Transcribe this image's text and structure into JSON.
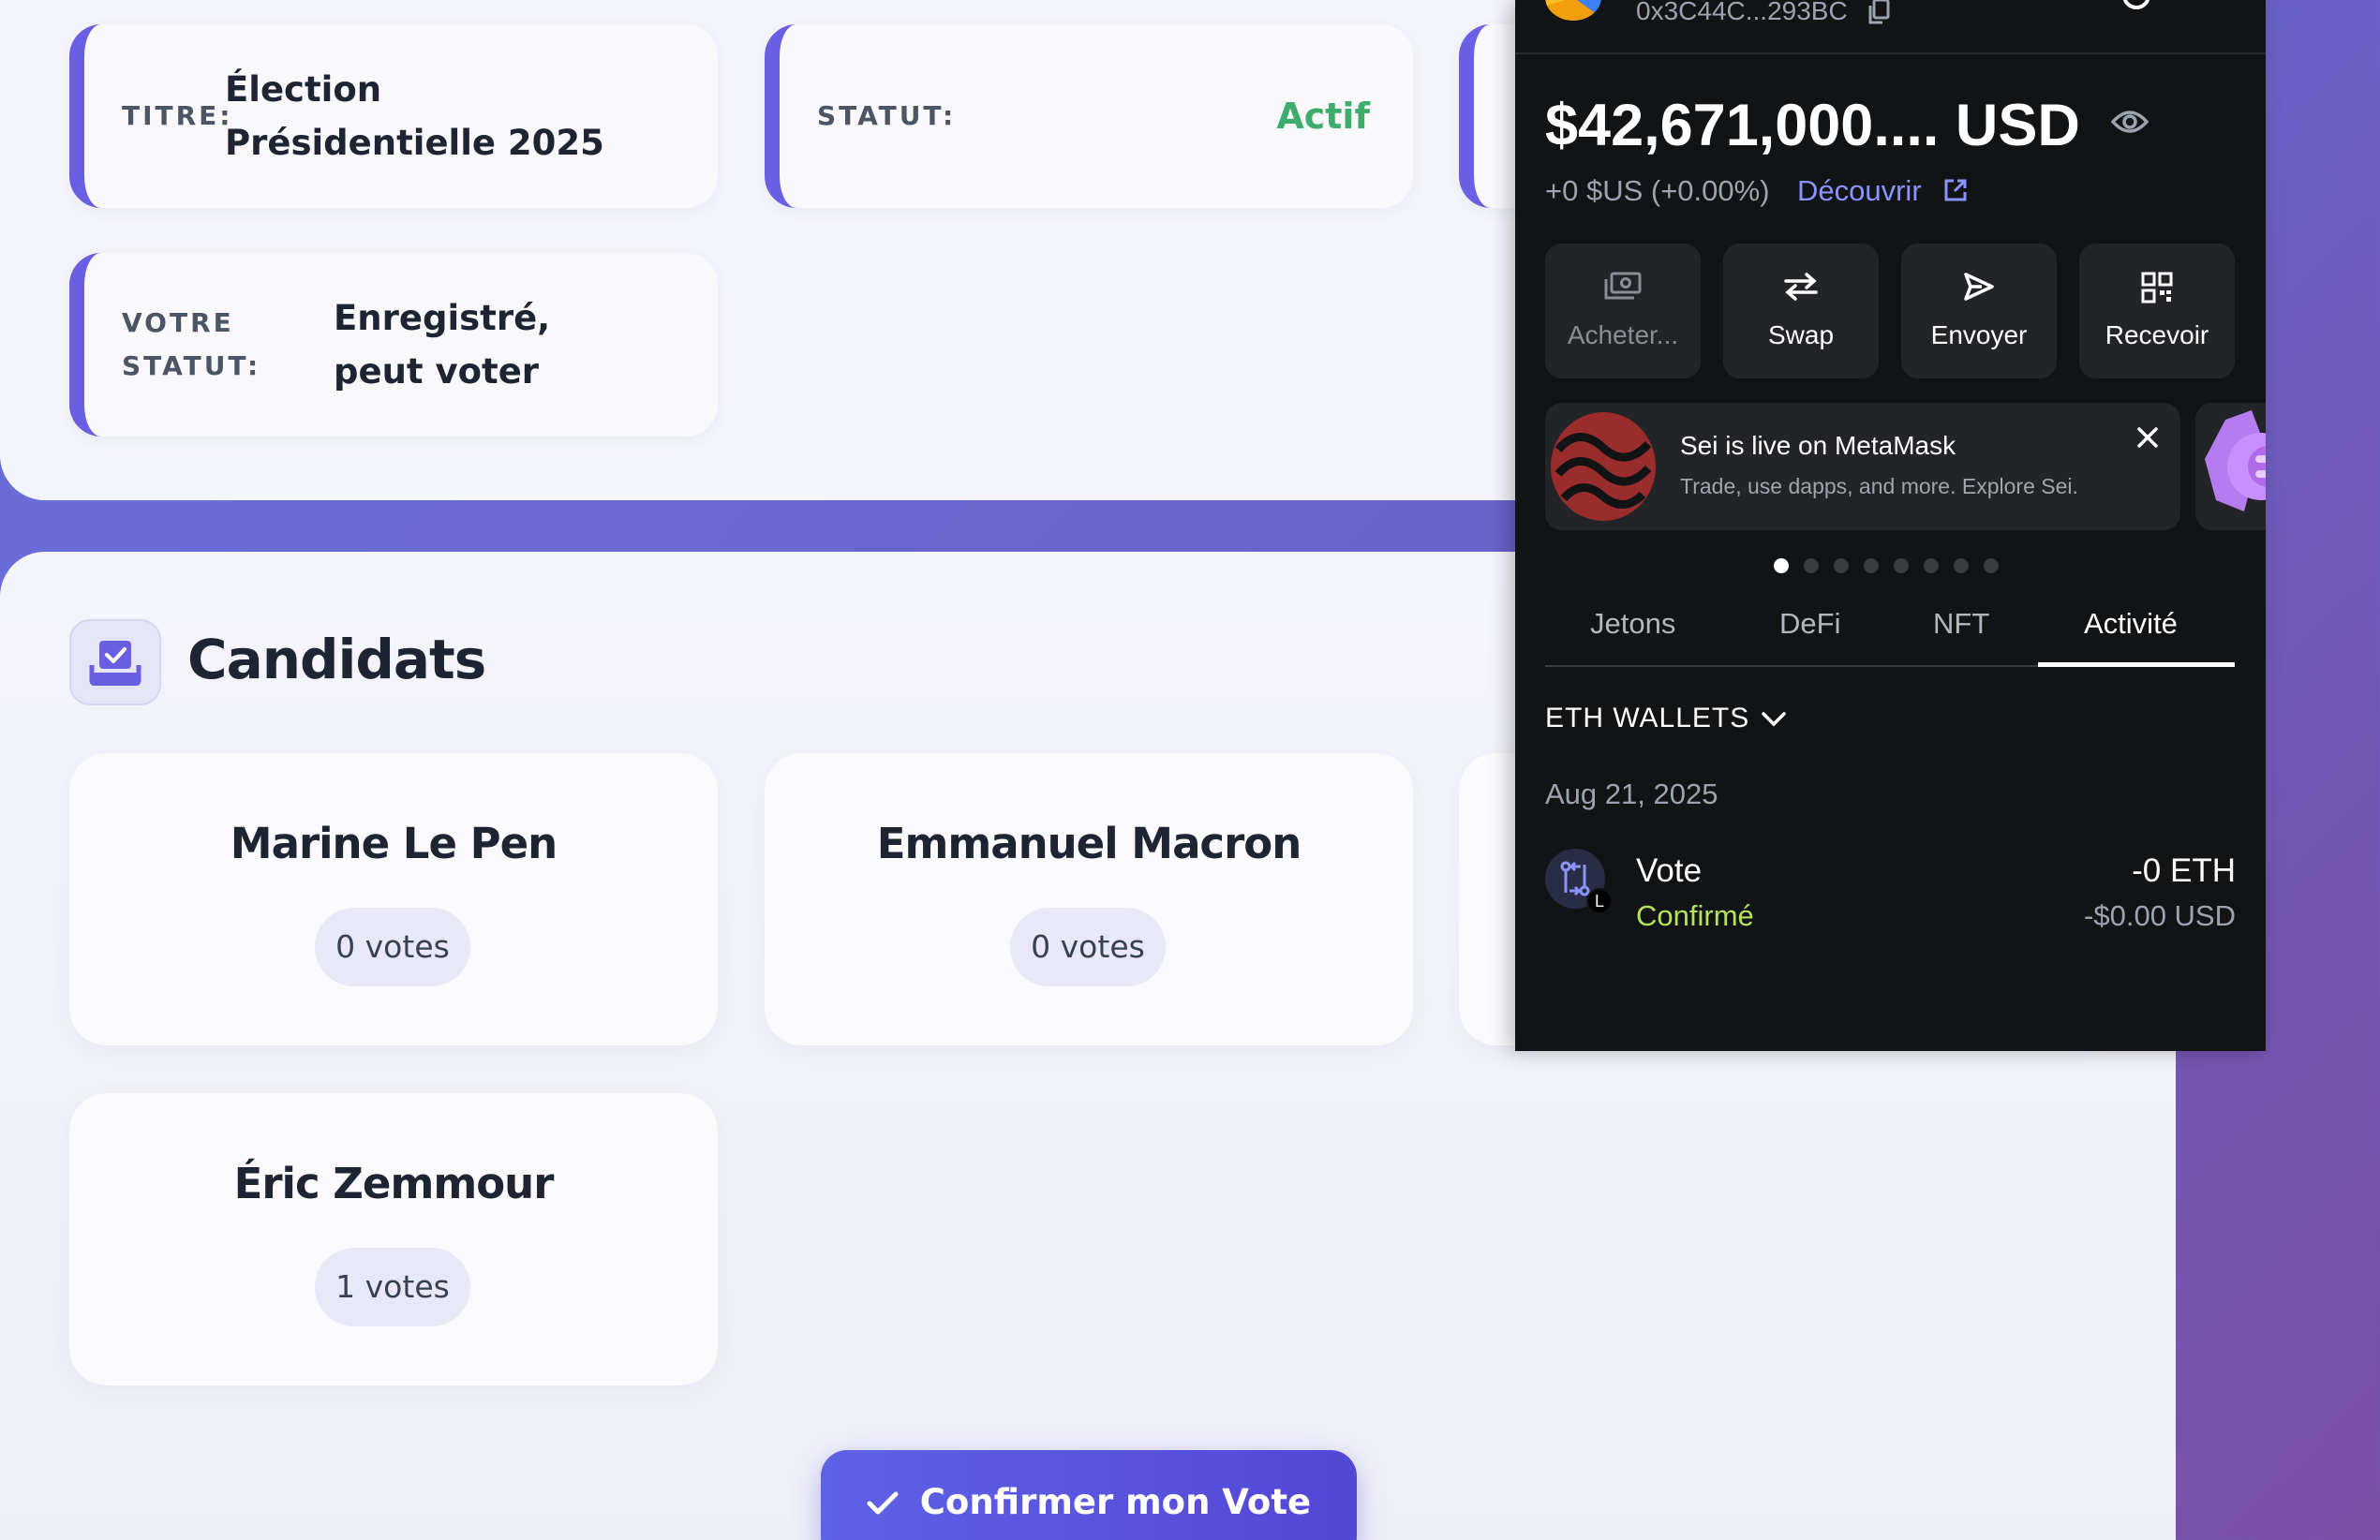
{
  "election": {
    "title_label": "TITRE:",
    "title_value": "Élection Présidentielle 2025",
    "status_label": "STATUT:",
    "status_value": "Actif",
    "voter_label": "VOTRE STATUT:",
    "voter_value": "Enregistré, peut voter"
  },
  "candidates_section": {
    "title": "Candidats",
    "icon": "ballot-box-check-icon",
    "items": [
      {
        "name": "Marine Le Pen",
        "votes": "0 votes"
      },
      {
        "name": "Emmanuel Macron",
        "votes": "0 votes"
      },
      {
        "name": "Éric Zemmour",
        "votes": "1 votes"
      }
    ]
  },
  "confirm_button": {
    "label": "Confirmer mon Vote",
    "icon": "check-icon"
  },
  "wallet": {
    "address": "0x3C44C...293BC",
    "balance": "$42,671,000.... USD",
    "change": "+0 $US (+0.00%)",
    "discover": "Découvrir",
    "actions": [
      {
        "label": "Acheter...",
        "icon": "cash-icon",
        "enabled": false
      },
      {
        "label": "Swap",
        "icon": "swap-arrows-icon",
        "enabled": true
      },
      {
        "label": "Envoyer",
        "icon": "send-icon",
        "enabled": true
      },
      {
        "label": "Recevoir",
        "icon": "qr-code-icon",
        "enabled": true
      }
    ],
    "banner": {
      "title": "Sei is live on MetaMask",
      "subtitle": "Trade, use dapps, and more. Explore Sei."
    },
    "carousel": {
      "count": 8,
      "active": 1
    },
    "tabs": [
      "Jetons",
      "DeFi",
      "NFT",
      "Activité"
    ],
    "active_tab": "Activité",
    "network_filter": "ETH WALLETS",
    "activity": {
      "date": "Aug 21, 2025",
      "tx": {
        "title": "Vote",
        "status": "Confirmé",
        "amount": "-0 ETH",
        "amount_usd": "-$0.00 USD",
        "badge": "L"
      }
    }
  },
  "colors": {
    "accent": "#6a5fe3",
    "status_active": "#3ead6c",
    "wallet_bg": "#121314",
    "wallet_link": "#8b93ff",
    "confirmed": "#b6e35a"
  }
}
